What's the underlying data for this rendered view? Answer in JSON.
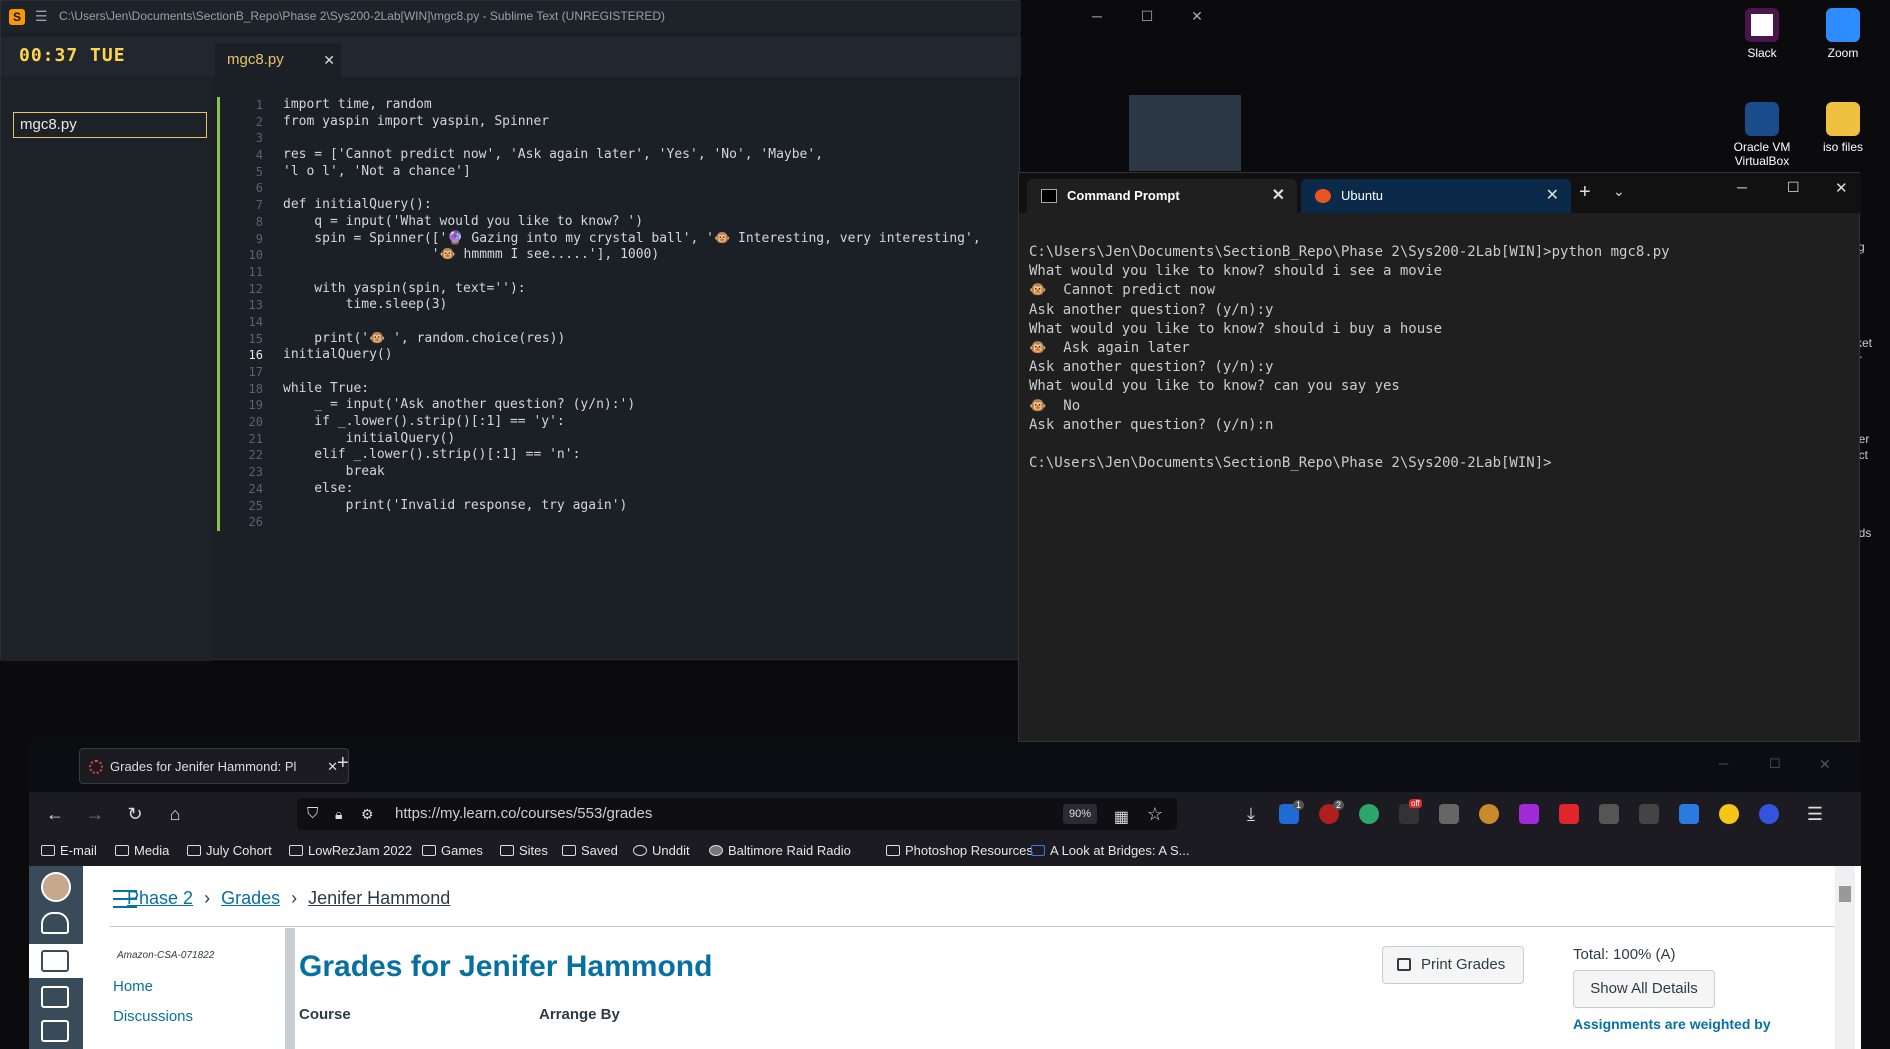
{
  "desktop": {
    "icons": [
      {
        "label": "Slack",
        "color": "#4a154b"
      },
      {
        "label": "Zoom",
        "color": "#2d8cff"
      },
      {
        "label": "Oracle VM VirtualBox",
        "color": "#1a4c8b"
      },
      {
        "label": "iso files",
        "color": "#f0c040"
      }
    ],
    "edge_text": [
      "g",
      "cket",
      "r",
      "per",
      "ect",
      "ads"
    ]
  },
  "sublime": {
    "title": "C:\\Users\\Jen\\Documents\\SectionB_Repo\\Phase 2\\Sys200-2Lab[WIN]\\mgc8.py - Sublime Text (UNREGISTERED)",
    "clock": "00:37 TUE",
    "tab": "mgc8.py",
    "sidebar_file": "mgc8.py",
    "current_line": "16",
    "lines": [
      "import time, random",
      "from yaspin import yaspin, Spinner",
      "",
      "res = ['Cannot predict now', 'Ask again later', 'Yes', 'No', 'Maybe',",
      "'l o l', 'Not a chance']",
      "",
      "def initialQuery():",
      "    q = input('What would you like to know? ')",
      "    spin = Spinner(['🔮 Gazing into my crystal ball', '🐵 Interesting, very interesting',",
      "                   '🐵 hmmmm I see.....'], 1000)",
      "",
      "    with yaspin(spin, text=''):",
      "        time.sleep(3)",
      "",
      "    print('🐵 ', random.choice(res))",
      "initialQuery()",
      "",
      "while True:",
      "    _ = input('Ask another question? (y/n):')",
      "    if _.lower().strip()[:1] == 'y':",
      "        initialQuery()",
      "    elif _.lower().strip()[:1] == 'n':",
      "        break",
      "    else:",
      "        print('Invalid response, try again')",
      ""
    ],
    "line_numbers": [
      "1",
      "2",
      "3",
      "4",
      "5",
      "6",
      "7",
      "8",
      "9",
      "10",
      "11",
      "12",
      "13",
      "14",
      "15",
      "16",
      "17",
      "18",
      "19",
      "20",
      "21",
      "22",
      "23",
      "24",
      "25",
      "26"
    ]
  },
  "terminal": {
    "tabs": [
      {
        "label": "Command Prompt"
      },
      {
        "label": "Ubuntu"
      }
    ],
    "new_tab": "+",
    "dropdown": "⌄",
    "output": [
      "C:\\Users\\Jen\\Documents\\SectionB_Repo\\Phase 2\\Sys200-2Lab[WIN]>python mgc8.py",
      "What would you like to know? should i see a movie",
      "🐵  Cannot predict now",
      "Ask another question? (y/n):y",
      "What would you like to know? should i buy a house",
      "🐵  Ask again later",
      "Ask another question? (y/n):y",
      "What would you like to know? can you say yes",
      "🐵  No",
      "Ask another question? (y/n):n",
      "",
      "C:\\Users\\Jen\\Documents\\SectionB_Repo\\Phase 2\\Sys200-2Lab[WIN]>"
    ]
  },
  "firefox": {
    "tab_title": "Grades for Jenifer Hammond: Pl",
    "new_tab": "+",
    "url": "https://my.learn.co/courses/553/grades",
    "zoom": "90%",
    "bookmarks": [
      "E-mail",
      "Media",
      "July Cohort",
      "LowRezJam 2022",
      "Games",
      "Sites",
      "Saved",
      "Unddit",
      "Baltimore Raid Radio",
      "Photoshop Resources",
      "A Look at Bridges: A S..."
    ],
    "ext_badges": [
      "1",
      "2",
      "off"
    ]
  },
  "page": {
    "breadcrumbs": [
      "Phase 2",
      "Grades",
      "Jenifer Hammond"
    ],
    "crumb_sep": "›",
    "course_code": "Amazon-CSA-071822",
    "course_nav": [
      "Home",
      "Discussions"
    ],
    "title": "Grades for Jenifer Hammond",
    "print_button": "Print Grades",
    "total": "Total: 100% (A)",
    "show_all": "Show All Details",
    "weighted": "Assignments are weighted by",
    "course_label": "Course",
    "arrange_label": "Arrange By"
  }
}
